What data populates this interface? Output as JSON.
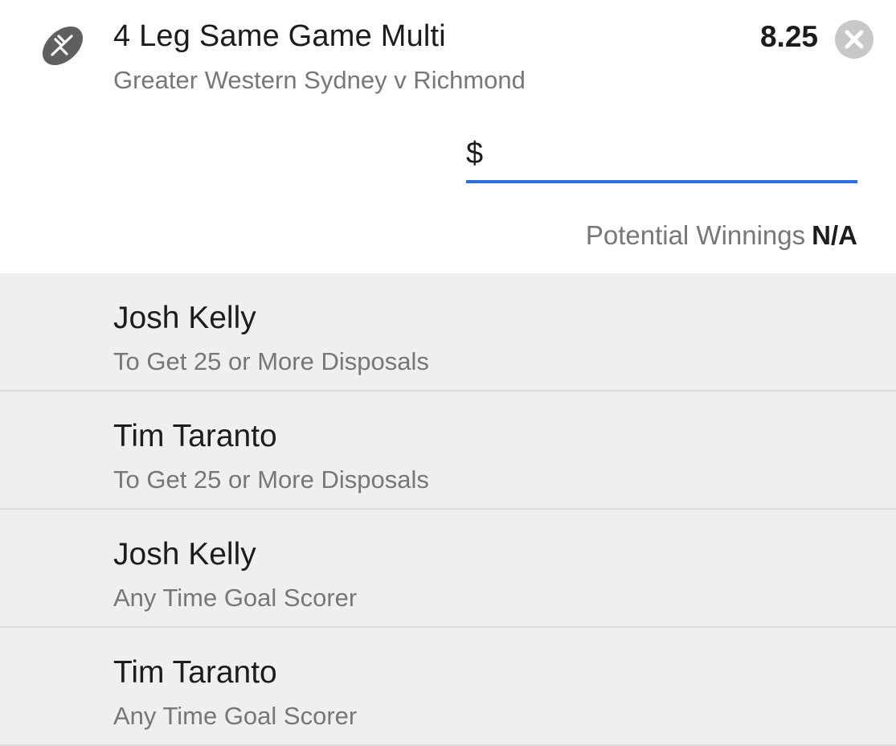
{
  "bet": {
    "title": "4 Leg Same Game Multi",
    "match": "Greater Western Sydney v Richmond",
    "odds": "8.25",
    "sport_icon": "football-icon",
    "close_icon": "close-icon"
  },
  "stake": {
    "prefix": "$",
    "value": "",
    "placeholder": ""
  },
  "winnings": {
    "label": "Potential Winnings",
    "value": "N/A"
  },
  "legs": [
    {
      "player": "Josh Kelly",
      "market": "To Get 25 or More Disposals"
    },
    {
      "player": "Tim Taranto",
      "market": "To Get 25 or More Disposals"
    },
    {
      "player": "Josh Kelly",
      "market": "Any Time Goal Scorer"
    },
    {
      "player": "Tim Taranto",
      "market": "Any Time Goal Scorer"
    }
  ],
  "colors": {
    "accent": "#2f6fd0",
    "list_background": "#efefef",
    "icon_gray": "#5f5f5f",
    "close_gray": "#c8c8c8"
  }
}
